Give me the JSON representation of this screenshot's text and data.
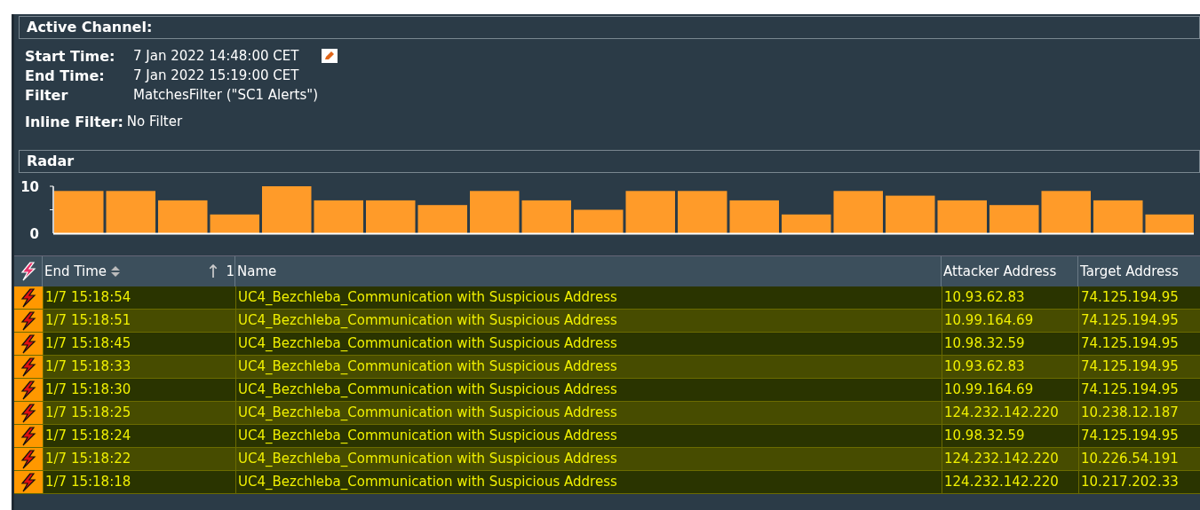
{
  "active_channel": {
    "title": "Active Channel:",
    "fields": [
      {
        "label": "Start Time:",
        "value": "7 Jan 2022 14:48:00 CET",
        "editable": true
      },
      {
        "label": "End Time:",
        "value": "7 Jan 2022 15:19:00 CET",
        "editable": false
      },
      {
        "label": "Filter",
        "value": "MatchesFilter (\"SC1 Alerts\")",
        "editable": false
      }
    ],
    "inline_filter": {
      "label": "Inline Filter:",
      "value": "No Filter"
    }
  },
  "radar": {
    "title": "Radar",
    "chart_data": {
      "type": "bar",
      "yticks": [
        0,
        10
      ],
      "ylim": [
        0,
        10
      ],
      "values": [
        9,
        9,
        7,
        4,
        10,
        7,
        7,
        6,
        9,
        7,
        5,
        9,
        9,
        7,
        4,
        9,
        8,
        7,
        6,
        9,
        7,
        4
      ]
    }
  },
  "table": {
    "columns": [
      {
        "label": "End Time",
        "sort_arrow": "↑",
        "sort_rank": "1"
      },
      {
        "label": "Name"
      },
      {
        "label": "Attacker Address"
      },
      {
        "label": "Target Address"
      }
    ],
    "rows": [
      {
        "end_time": "1/7 15:18:54",
        "name": "UC4_Bezchleba_Communication with Suspicious Address",
        "attacker": "10.93.62.83",
        "target": "74.125.194.95"
      },
      {
        "end_time": "1/7 15:18:51",
        "name": "UC4_Bezchleba_Communication with Suspicious Address",
        "attacker": "10.99.164.69",
        "target": "74.125.194.95"
      },
      {
        "end_time": "1/7 15:18:45",
        "name": "UC4_Bezchleba_Communication with Suspicious Address",
        "attacker": "10.98.32.59",
        "target": "74.125.194.95"
      },
      {
        "end_time": "1/7 15:18:33",
        "name": "UC4_Bezchleba_Communication with Suspicious Address",
        "attacker": "10.93.62.83",
        "target": "74.125.194.95"
      },
      {
        "end_time": "1/7 15:18:30",
        "name": "UC4_Bezchleba_Communication with Suspicious Address",
        "attacker": "10.99.164.69",
        "target": "74.125.194.95"
      },
      {
        "end_time": "1/7 15:18:25",
        "name": "UC4_Bezchleba_Communication with Suspicious Address",
        "attacker": "124.232.142.220",
        "target": "10.238.12.187"
      },
      {
        "end_time": "1/7 15:18:24",
        "name": "UC4_Bezchleba_Communication with Suspicious Address",
        "attacker": "10.98.32.59",
        "target": "74.125.194.95"
      },
      {
        "end_time": "1/7 15:18:22",
        "name": "UC4_Bezchleba_Communication with Suspicious Address",
        "attacker": "124.232.142.220",
        "target": "10.226.54.191"
      },
      {
        "end_time": "1/7 15:18:18",
        "name": "UC4_Bezchleba_Communication with Suspicious Address",
        "attacker": "124.232.142.220",
        "target": "10.217.202.33"
      }
    ]
  }
}
